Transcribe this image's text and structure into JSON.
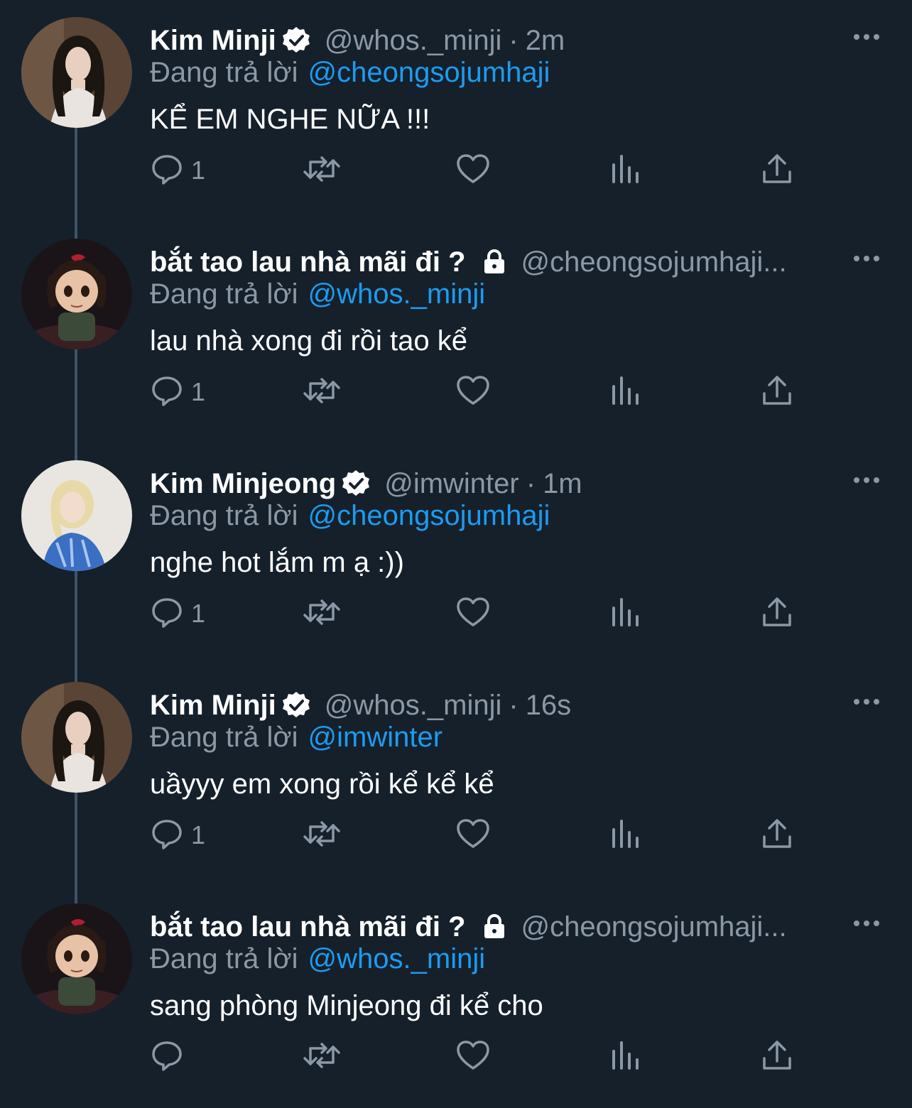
{
  "tweets": [
    {
      "name": "Kim Minji",
      "verified": true,
      "locked": false,
      "handle": "@whos._minji",
      "time": "2m",
      "replying_label": "Đang trả lời",
      "replying_to": "@cheongsojumhaji",
      "text": "KỂ EM NGHE NỮA !!!",
      "reply_count": "1",
      "avatar": "minji-avatar"
    },
    {
      "name": "bắt tao lau nhà mãi đi ?",
      "verified": false,
      "locked": true,
      "handle": "@cheongsojumhaji...",
      "time": "",
      "replying_label": "Đang trả lời",
      "replying_to": "@whos._minji",
      "text": "lau nhà xong đi rồi tao kể",
      "reply_count": "1",
      "avatar": "cartoon-girl-avatar"
    },
    {
      "name": "Kim Minjeong",
      "verified": true,
      "locked": false,
      "handle": "@imwinter",
      "time": "1m",
      "replying_label": "Đang trả lời",
      "replying_to": "@cheongsojumhaji",
      "text": "nghe hot lắm m ạ :))",
      "reply_count": "1",
      "avatar": "minjeong-avatar"
    },
    {
      "name": "Kim Minji",
      "verified": true,
      "locked": false,
      "handle": "@whos._minji",
      "time": "16s",
      "replying_label": "Đang trả lời",
      "replying_to": "@imwinter",
      "text": "uầyyy em xong rồi kể kể kể",
      "reply_count": "1",
      "avatar": "minji-avatar"
    },
    {
      "name": "bắt tao lau nhà mãi đi ?",
      "verified": false,
      "locked": true,
      "handle": "@cheongsojumhaji...",
      "time": "",
      "replying_label": "Đang trả lời",
      "replying_to": "@whos._minji",
      "text": "sang phòng Minjeong đi kể cho",
      "reply_count": "",
      "avatar": "cartoon-girl-avatar"
    }
  ],
  "colors": {
    "background": "#15202b",
    "text": "#ffffff",
    "muted": "#8b98a5",
    "link": "#1d9bf0",
    "thread_line": "#3d5466"
  }
}
